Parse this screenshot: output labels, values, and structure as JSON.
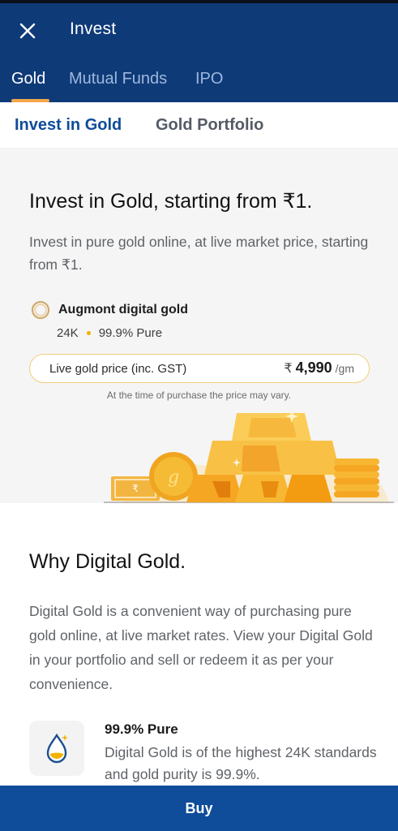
{
  "header": {
    "title": "Invest",
    "close_icon": "close-icon",
    "background": "#0f3a78"
  },
  "top_tabs": [
    {
      "label": "Gold",
      "active": true
    },
    {
      "label": "Mutual Funds",
      "active": false
    },
    {
      "label": "IPO",
      "active": false
    }
  ],
  "sub_tabs": [
    {
      "label": "Invest in Gold",
      "active": true
    },
    {
      "label": "Gold Portfolio",
      "active": false
    }
  ],
  "hero": {
    "title": "Invest in Gold, starting from ₹1.",
    "subtitle": "Invest in pure gold online, at live market price, starting from ₹1.",
    "provider": {
      "icon": "augmont-ring-icon",
      "name": "Augmont digital gold",
      "karat": "24K",
      "purity": "99.9% Pure"
    },
    "live_price": {
      "label": "Live gold price (inc. GST)",
      "currency": "₹",
      "amount": "4,990",
      "unit": "/gm"
    },
    "note": "At the time of purchase the price may vary."
  },
  "why": {
    "title": "Why Digital Gold.",
    "body": "Digital Gold is a convenient way of purchasing pure gold online, at live market rates. View your Digital Gold in your portfolio and sell or redeem it as per your convenience."
  },
  "feature": {
    "icon": "gold-drop-icon",
    "title": "99.9% Pure",
    "body": "Digital Gold is of the highest 24K standards and gold purity is 99.9%."
  },
  "footer": {
    "buy_label": "Buy"
  },
  "colors": {
    "brand_blue": "#0f4c9a",
    "accent_gold": "#f2a64b"
  }
}
